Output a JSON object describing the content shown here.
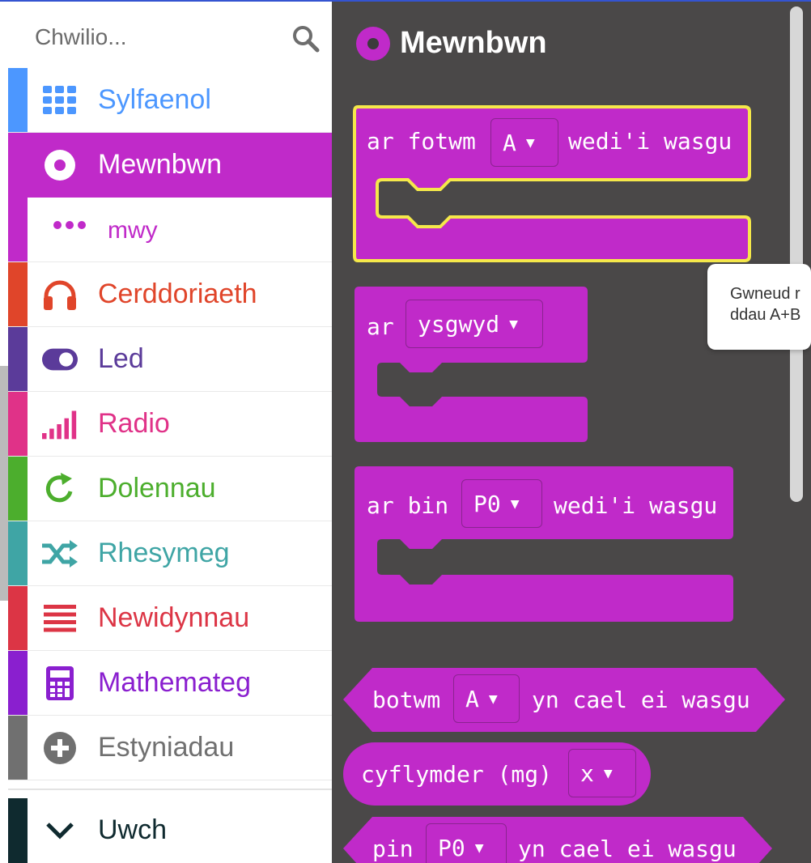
{
  "search": {
    "placeholder": "Chwilio..."
  },
  "categories": [
    {
      "label": "Sylfaenol",
      "color": "#4c97ff",
      "icon": "grid-icon"
    },
    {
      "label": "Mewnbwn",
      "color": "#c02ac9",
      "icon": "radio-button-icon"
    },
    {
      "label": "Cerddoriaeth",
      "color": "#e0452a",
      "icon": "headphones-icon"
    },
    {
      "label": "Led",
      "color": "#5b3b9a",
      "icon": "toggle-icon"
    },
    {
      "label": "Radio",
      "color": "#e03288",
      "icon": "signal-bars-icon"
    },
    {
      "label": "Dolennau",
      "color": "#4cae2d",
      "icon": "loop-arrow-icon"
    },
    {
      "label": "Rhesymeg",
      "color": "#3fa5a5",
      "icon": "shuffle-icon"
    },
    {
      "label": "Newidynnau",
      "color": "#dc3545",
      "icon": "lines-icon"
    },
    {
      "label": "Mathemateg",
      "color": "#8a1fcf",
      "icon": "calculator-icon"
    },
    {
      "label": "Estyniadau",
      "color": "#707070",
      "icon": "plus-circle-icon"
    },
    {
      "label": "Uwch",
      "color": "#0f2a2f",
      "icon": "chevron-down-icon"
    }
  ],
  "sub": {
    "label": "mwy",
    "icon": "more-dots-icon"
  },
  "workspace": {
    "title": "Mewnbwn",
    "blocks": {
      "b1": {
        "a": "ar fotwm",
        "dd": "A",
        "b": "wedi'i wasgu"
      },
      "b2": {
        "a": "ar",
        "dd": "ysgwyd"
      },
      "b3": {
        "a": "ar bin",
        "dd": "P0",
        "b": "wedi'i wasgu"
      },
      "b4": {
        "a": "botwm",
        "dd": "A",
        "b": "yn cael ei wasgu"
      },
      "b5": {
        "a": "cyflymder (mg)",
        "dd": "x"
      },
      "b6": {
        "a": "pin",
        "dd": "P0",
        "b": "yn cael ei wasgu"
      }
    },
    "tooltip": {
      "line1": "Gwneud r",
      "line2": "ddau A+B"
    }
  },
  "colors": {
    "block": "#c02ac9",
    "workspace_bg": "#4a4848",
    "highlight": "#f5e84a"
  }
}
